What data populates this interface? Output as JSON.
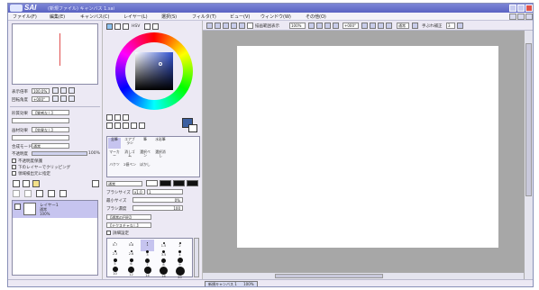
{
  "window": {
    "app_name": "SAI",
    "document_title": "(新規ファイル) キャンバス 1.sai"
  },
  "menu": {
    "items": [
      "ファイル(F)",
      "編集(E)",
      "キャンバス(C)",
      "レイヤー(L)",
      "選択(S)",
      "フィルタ(T)",
      "ビュー(V)",
      "ウィンドウ(W)",
      "その他(O)"
    ]
  },
  "navigator": {
    "zoom_label": "表示倍率",
    "zoom_value": "100.0%",
    "angle_label": "回転角度",
    "angle_value": "+000°"
  },
  "layer_props": {
    "brush_label": "形質効果",
    "brush_value": "【質感なし】",
    "paper_label": "画材効果",
    "paper_value": "【効果なし】",
    "mode_label": "合成モード",
    "mode_value": "通常",
    "opacity_label": "不透明度",
    "opacity_value": "100%",
    "check1": "不透明度保護",
    "check2": "下のレイヤーでクリッピング",
    "check3": "領域検出元に指定"
  },
  "layers": {
    "items": [
      {
        "name": "レイヤー1",
        "mode": "通常",
        "opacity": "100%"
      }
    ]
  },
  "color_panel": {
    "tab_labels": [
      "HSV"
    ]
  },
  "tools": {
    "items": [
      "鉛筆",
      "エアブラシ",
      "筆",
      "水彩筆",
      "マーカー",
      "消しゴム",
      "選択ペン",
      "選択消し",
      "バケツ",
      "2値ペン",
      "ぼかし",
      ""
    ]
  },
  "brush": {
    "mode_value": "通常",
    "size_label": "ブラシサイズ",
    "size_mult": "x1.0",
    "size_value": "1",
    "min_size_label": "最小サイズ",
    "min_size_value": "0%",
    "density_label": "ブラシ濃度",
    "density_value": "100",
    "shape_value": "【通常の円形】",
    "texture_value": "【テクスチャなし】",
    "detail_label": "詳細設定",
    "sizes": [
      "0.7",
      "0.8",
      "1",
      "1.5",
      "2",
      "2.3",
      "2.6",
      "3",
      "3.5",
      "4",
      "5",
      "6",
      "7",
      "8",
      "9",
      "10",
      "12",
      "14",
      "16",
      "20"
    ]
  },
  "canvas_toolbar": {
    "stabilizer_label": "描画範囲表示",
    "zoom_value": "100%",
    "angle_value": "+000°",
    "normal_label": "通常",
    "hand_label": "手ぶれ補正",
    "hand_value": "3"
  },
  "status": {
    "tab_label": "新規キャンバス 1",
    "tab_zoom": "100%"
  },
  "colors": {
    "accent": "#5a63c2",
    "canvas_bg": "#a7a7a7",
    "primary_color": "#3b5fa0"
  }
}
